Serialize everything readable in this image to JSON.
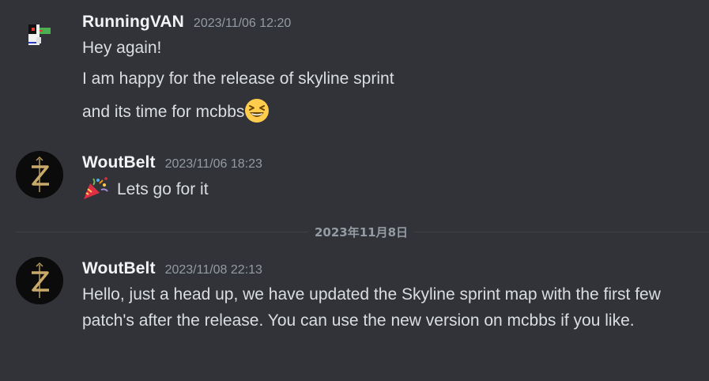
{
  "messages": [
    {
      "author": "RunningVAN",
      "timestamp": "2023/11/06 12:20",
      "lines": [
        "Hey again!",
        "I am happy for the release of skyline sprint",
        "and its time for mcbbs"
      ],
      "trailing_emoji": "grinning-squinting-face"
    },
    {
      "author": "WoutBelt",
      "timestamp": "2023/11/06 18:23",
      "leading_emoji": "party-popper",
      "text": "Lets go for it"
    },
    {
      "author": "WoutBelt",
      "timestamp": "2023/11/08 22:13",
      "text": "Hello, just a head up, we have updated the Skyline sprint map with the first few patch's after the release. You can use the new version on mcbbs if you like."
    }
  ],
  "date_divider": "2023年11月8日",
  "colors": {
    "background": "#313338",
    "username": "#f2f3f5",
    "text": "#dbdee1",
    "muted": "#949ba4",
    "divider": "#3f4147"
  }
}
